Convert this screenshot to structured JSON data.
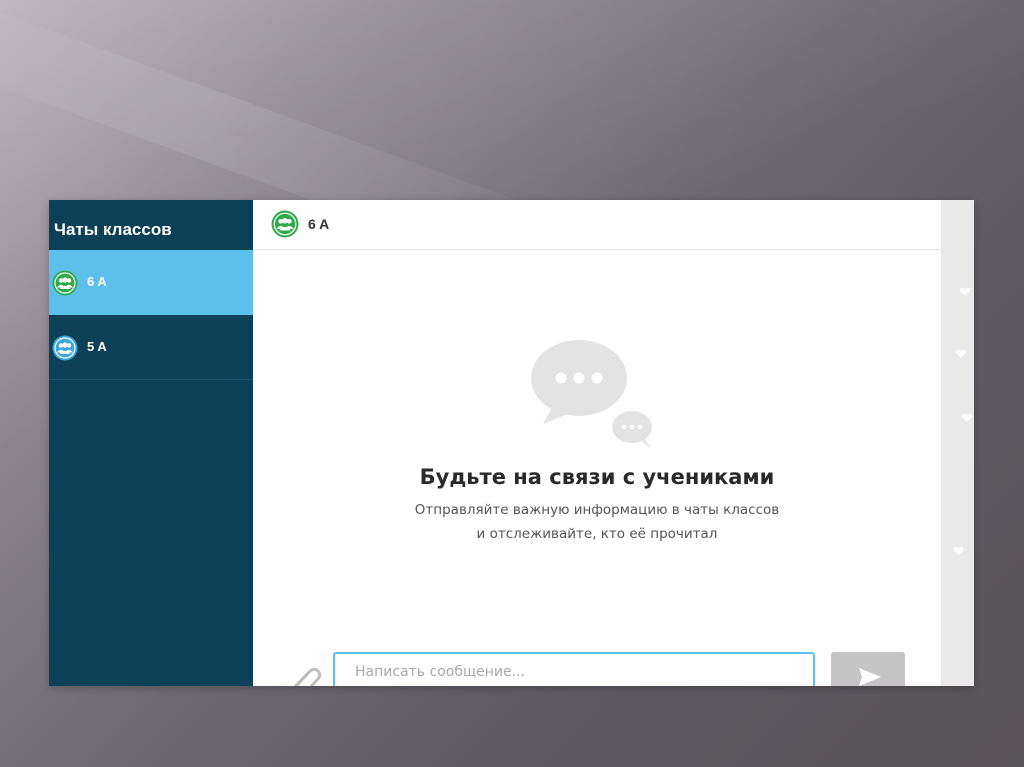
{
  "sidebar": {
    "title": "Чаты классов",
    "chats": [
      {
        "label": "6 A",
        "active": true,
        "avatar_color": "#2eaa4a"
      },
      {
        "label": "5 A",
        "active": false,
        "avatar_color": "#3aa6d8"
      }
    ]
  },
  "header": {
    "chat_name": "6 A",
    "avatar_color": "#2eaa4a"
  },
  "empty_state": {
    "icon": "chat-bubbles-icon",
    "title": "Будьте на связи с учениками",
    "line1": "Отправляйте важную информацию в чаты классов",
    "line2": "и отслеживайте, кто её прочитал"
  },
  "composer": {
    "attach_icon": "paperclip-icon",
    "placeholder": "Написать сообщение...",
    "value": "",
    "send_icon": "send-icon"
  },
  "colors": {
    "sidebar_bg": "#0c4057",
    "active_item": "#5bc0eb",
    "input_border": "#5bc0eb",
    "send_button": "#c4c4c4"
  }
}
